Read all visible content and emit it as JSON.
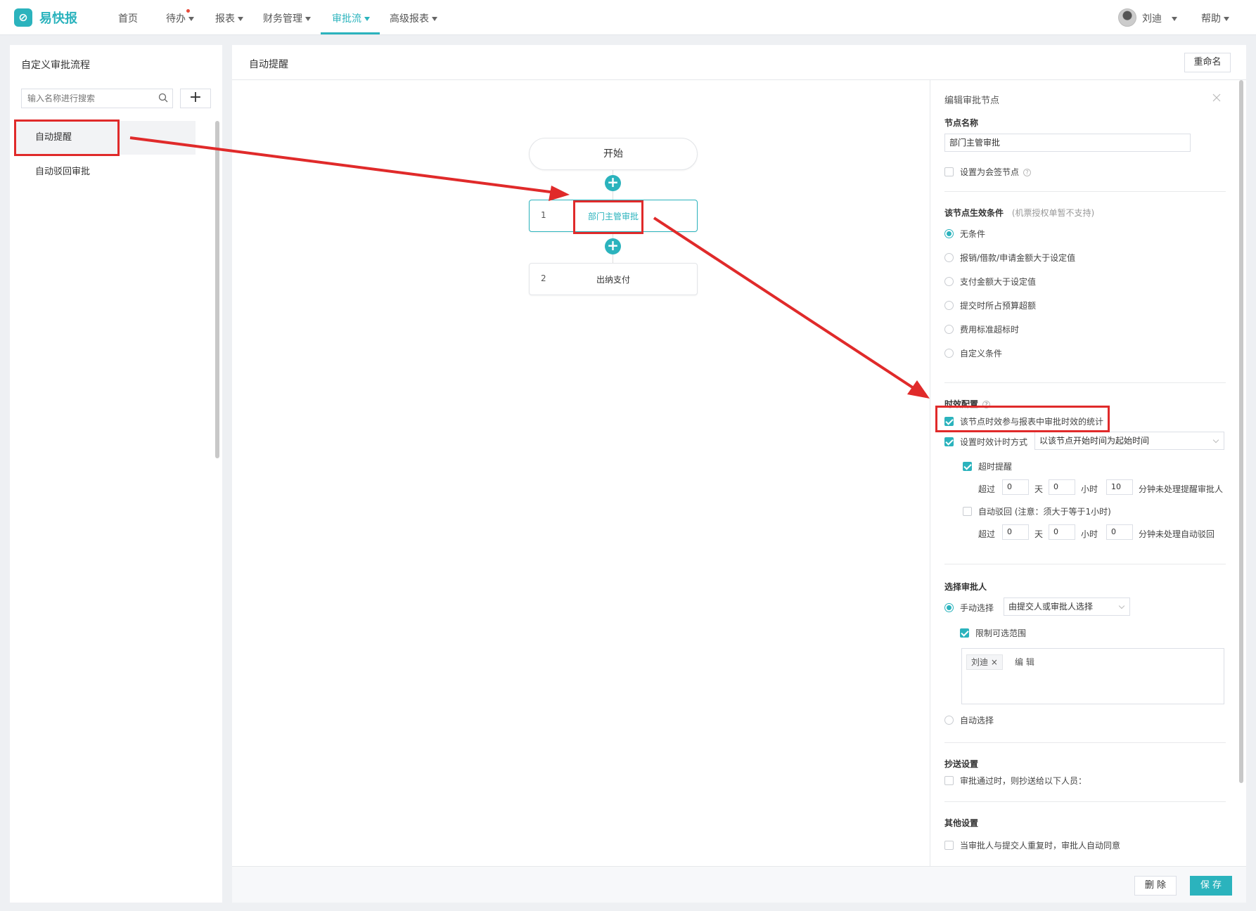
{
  "topbar": {
    "logo_text": "易快报",
    "nav": {
      "home": "首页",
      "todo": "待办",
      "reports": "报表",
      "finance": "财务管理",
      "approval": "审批流",
      "advanced": "高级报表"
    },
    "user": "刘迪",
    "help": "帮助"
  },
  "sidebar": {
    "title": "自定义审批流程",
    "search_placeholder": "输入名称进行搜索",
    "add_label": "+",
    "items": [
      {
        "label": "自动提醒"
      },
      {
        "label": "自动驳回审批"
      }
    ]
  },
  "main": {
    "title": "自动提醒",
    "rename": "重命名",
    "flow": {
      "start": "开始",
      "nodes": [
        {
          "num": "1",
          "name": "部门主管审批"
        },
        {
          "num": "2",
          "name": "出纳支付"
        }
      ]
    },
    "footer": {
      "delete": "删 除",
      "save": "保 存"
    }
  },
  "edit": {
    "title": "编辑审批节点",
    "node_name_label": "节点名称",
    "node_name_value": "部门主管审批",
    "countersign": "设置为会签节点",
    "condition_label": "该节点生效条件",
    "condition_note": "(机票授权单暂不支持)",
    "conditions": [
      "无条件",
      "报销/借款/申请金额大于设定值",
      "支付金额大于设定值",
      "提交时所占预算超额",
      "费用标准超标时",
      "自定义条件"
    ],
    "timing_label": "时效配置",
    "timing_stat": "该节点时效参与报表中审批时效的统计",
    "timing_mode": "设置时效计时方式",
    "timing_mode_value": "以该节点开始时间为起始时间",
    "overtime_remind": "超时提醒",
    "exceed": "超过",
    "day": "天",
    "hour": "小时",
    "remind_tail": "分钟未处理提醒审批人",
    "remind_values": {
      "days": "0",
      "hours": "0",
      "minutes": "10"
    },
    "auto_reject": "自动驳回",
    "auto_reject_note": "(注意：须大于等于1小时)",
    "reject_tail": "分钟未处理自动驳回",
    "reject_values": {
      "days": "0",
      "hours": "0",
      "minutes": "0"
    },
    "approver_label": "选择审批人",
    "manual_select": "手动选择",
    "manual_select_value": "由提交人或审批人选择",
    "limit_scope": "限制可选范围",
    "tag_user": "刘迪",
    "tag_edit": "编 辑",
    "auto_select": "自动选择",
    "cc_label": "抄送设置",
    "cc_text": "审批通过时，则抄送给以下人员：",
    "other_label": "其他设置",
    "other_text": "当审批人与提交人重复时，审批人自动同意"
  },
  "colors": {
    "accent": "#2bb3bd",
    "annotation": "#e02a2a"
  }
}
